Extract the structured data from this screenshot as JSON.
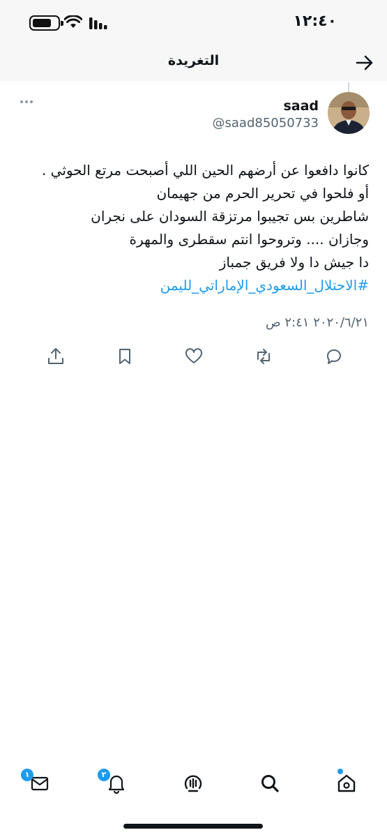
{
  "status_bar": {
    "time": "١٢:٤٠"
  },
  "header": {
    "title": "التغريدة",
    "back_icon": "arrow-right-icon"
  },
  "tweet": {
    "author": {
      "name": "saad",
      "handle": "@saad85050733"
    },
    "lines": [
      "كانوا دافعوا عن أرضهم الحين اللي أصبحت مرتع الحوثي .",
      "أو فلحوا في تحرير الحرم من جهيمان",
      "شاطرين بس تجيبوا مرتزقة السودان على نجران",
      "وجازان .... وتروحوا انتم سقطرى والمهرة",
      "دا جيش دا ولا فريق جمباز"
    ],
    "hashtag": "#الاحتلال_السعودي_الإماراتي_لليمن",
    "timestamp": "٢٠٢٠/٦/٢١ ٢:٤١ ص"
  },
  "actions": [
    {
      "name": "reply",
      "icon": "reply-icon"
    },
    {
      "name": "retweet",
      "icon": "retweet-icon"
    },
    {
      "name": "like",
      "icon": "heart-icon"
    },
    {
      "name": "bookmark",
      "icon": "bookmark-icon"
    },
    {
      "name": "share",
      "icon": "share-icon"
    }
  ],
  "tabbar": {
    "messages_badge": "١",
    "notifications_badge": "٢",
    "icons": [
      "home-icon",
      "search-icon",
      "spaces-icon",
      "notifications-icon",
      "messages-icon"
    ]
  },
  "colors": {
    "accent": "#1d9bf0",
    "text": "#0f1419",
    "secondary": "#536471",
    "header_bg": "#f7f7f7"
  }
}
